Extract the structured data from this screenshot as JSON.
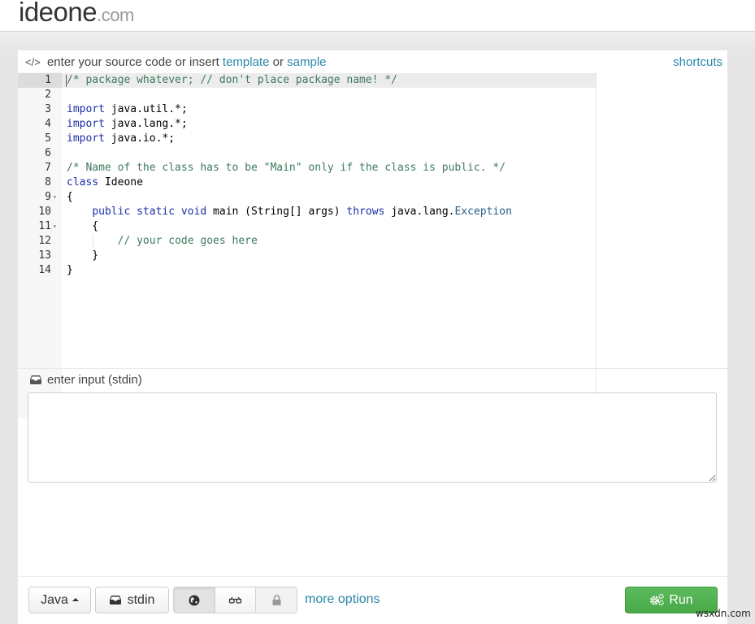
{
  "header": {
    "logo_main": "ideone",
    "logo_tld": ".com"
  },
  "source": {
    "prompt_prefix": "enter your source code or insert",
    "template_link": "template",
    "or_text": "or",
    "sample_link": "sample",
    "shortcuts_link": "shortcuts",
    "icon": "code-icon"
  },
  "editor": {
    "active_line": 1,
    "lines": [
      {
        "n": "1",
        "fold": false,
        "tokens": [
          {
            "c": "cm",
            "t": "/* package whatever; // don't place package name! */"
          }
        ]
      },
      {
        "n": "2",
        "fold": false,
        "tokens": []
      },
      {
        "n": "3",
        "fold": false,
        "tokens": [
          {
            "c": "kw",
            "t": "import"
          },
          {
            "c": "",
            "t": " java.util.*;"
          }
        ]
      },
      {
        "n": "4",
        "fold": false,
        "tokens": [
          {
            "c": "kw",
            "t": "import"
          },
          {
            "c": "",
            "t": " java.lang.*;"
          }
        ]
      },
      {
        "n": "5",
        "fold": false,
        "tokens": [
          {
            "c": "kw",
            "t": "import"
          },
          {
            "c": "",
            "t": " java.io.*;"
          }
        ]
      },
      {
        "n": "6",
        "fold": false,
        "tokens": []
      },
      {
        "n": "7",
        "fold": false,
        "tokens": [
          {
            "c": "cm",
            "t": "/* Name of the class has to be \"Main\" only if the class is public. */"
          }
        ]
      },
      {
        "n": "8",
        "fold": false,
        "tokens": [
          {
            "c": "kw",
            "t": "class"
          },
          {
            "c": "",
            "t": " Ideone"
          }
        ]
      },
      {
        "n": "9",
        "fold": true,
        "tokens": [
          {
            "c": "",
            "t": "{"
          }
        ]
      },
      {
        "n": "10",
        "fold": false,
        "tokens": [
          {
            "c": "",
            "t": "    "
          },
          {
            "c": "kw",
            "t": "public"
          },
          {
            "c": "",
            "t": " "
          },
          {
            "c": "kw",
            "t": "static"
          },
          {
            "c": "",
            "t": " "
          },
          {
            "c": "kw",
            "t": "void"
          },
          {
            "c": "",
            "t": " main (String[] args) "
          },
          {
            "c": "kw",
            "t": "throws"
          },
          {
            "c": "",
            "t": " java.lang."
          },
          {
            "c": "ty",
            "t": "Exception"
          }
        ]
      },
      {
        "n": "11",
        "fold": true,
        "tokens": [
          {
            "c": "",
            "t": "    {"
          }
        ]
      },
      {
        "n": "12",
        "fold": false,
        "tokens": [
          {
            "c": "",
            "t": "        "
          },
          {
            "c": "cm",
            "t": "// your code goes here"
          }
        ]
      },
      {
        "n": "13",
        "fold": false,
        "tokens": [
          {
            "c": "",
            "t": "    }"
          }
        ]
      },
      {
        "n": "14",
        "fold": false,
        "tokens": [
          {
            "c": "",
            "t": "}"
          }
        ]
      }
    ]
  },
  "stdin": {
    "label": "enter input (stdin)",
    "value": "",
    "placeholder": ""
  },
  "toolbar": {
    "language_label": "Java",
    "stdin_label": "stdin",
    "visibility_options": [
      {
        "name": "public",
        "icon": "globe-icon",
        "active": true
      },
      {
        "name": "secret",
        "icon": "glasses-icon",
        "active": false
      },
      {
        "name": "private",
        "icon": "lock-icon",
        "active": false,
        "disabled": true
      }
    ],
    "more_options_label": "more options",
    "run_label": "Run"
  },
  "colors": {
    "link": "#2a87a8",
    "run_button": "#52b352",
    "comment": "#3d7a5a",
    "keyword": "#1c2ea8"
  },
  "watermark": "wsxdn.com"
}
